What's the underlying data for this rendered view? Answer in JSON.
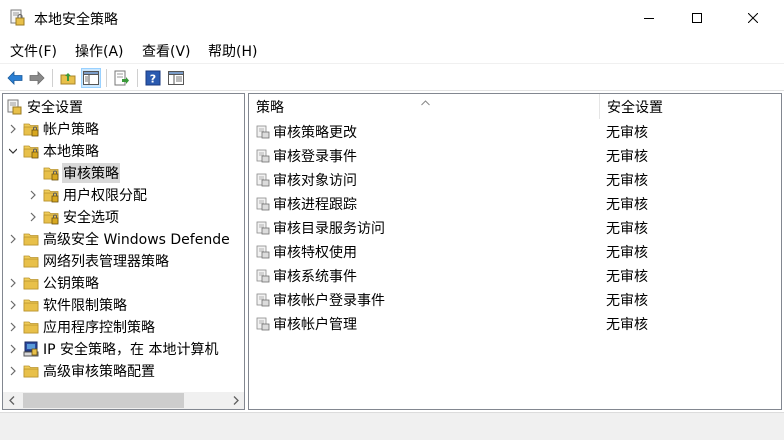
{
  "window": {
    "title": "本地安全策略",
    "icon": "local-security-policy-icon",
    "controls": [
      "minimize-icon",
      "maximize-icon",
      "close-icon"
    ]
  },
  "menu": [
    "文件(F)",
    "操作(A)",
    "查看(V)",
    "帮助(H)"
  ],
  "toolbar": {
    "buttons": [
      "back-arrow-icon",
      "forward-arrow-icon",
      "up-folder-icon",
      "show-hide-tree-icon",
      "export-list-icon",
      "help-icon",
      "properties-icon"
    ]
  },
  "tree": {
    "root": "安全设置",
    "items": [
      {
        "label": "帐户策略",
        "expander": "collapsed",
        "icon": "folder-lock-icon"
      },
      {
        "label": "本地策略",
        "expander": "expanded",
        "icon": "folder-lock-icon"
      },
      {
        "label": "审核策略",
        "expander": "none",
        "icon": "folder-lock-icon",
        "selected": true
      },
      {
        "label": "用户权限分配",
        "expander": "collapsed",
        "icon": "folder-lock-icon"
      },
      {
        "label": "安全选项",
        "expander": "collapsed",
        "icon": "folder-lock-icon"
      },
      {
        "label": "高级安全 Windows Defende",
        "expander": "collapsed",
        "icon": "folder-icon"
      },
      {
        "label": "网络列表管理器策略",
        "expander": "none",
        "icon": "folder-icon"
      },
      {
        "label": "公钥策略",
        "expander": "collapsed",
        "icon": "folder-icon"
      },
      {
        "label": "软件限制策略",
        "expander": "collapsed",
        "icon": "folder-icon"
      },
      {
        "label": "应用程序控制策略",
        "expander": "collapsed",
        "icon": "folder-icon"
      },
      {
        "label": "IP 安全策略，在 本地计算机",
        "expander": "collapsed",
        "icon": "ip-security-icon"
      },
      {
        "label": "高级审核策略配置",
        "expander": "collapsed",
        "icon": "folder-icon"
      }
    ]
  },
  "list": {
    "columns": [
      "策略",
      "安全设置"
    ],
    "rows": [
      {
        "policy": "审核策略更改",
        "setting": "无审核"
      },
      {
        "policy": "审核登录事件",
        "setting": "无审核"
      },
      {
        "policy": "审核对象访问",
        "setting": "无审核"
      },
      {
        "policy": "审核进程跟踪",
        "setting": "无审核"
      },
      {
        "policy": "审核目录服务访问",
        "setting": "无审核"
      },
      {
        "policy": "审核特权使用",
        "setting": "无审核"
      },
      {
        "policy": "审核系统事件",
        "setting": "无审核"
      },
      {
        "policy": "审核帐户登录事件",
        "setting": "无审核"
      },
      {
        "policy": "审核帐户管理",
        "setting": "无审核"
      }
    ]
  },
  "colors": {
    "selection_bg": "#d9d9d9",
    "toolbar_active_bg": "#cce8ff",
    "folder_yellow": "#e8c04a",
    "panel_border": "#828790"
  }
}
